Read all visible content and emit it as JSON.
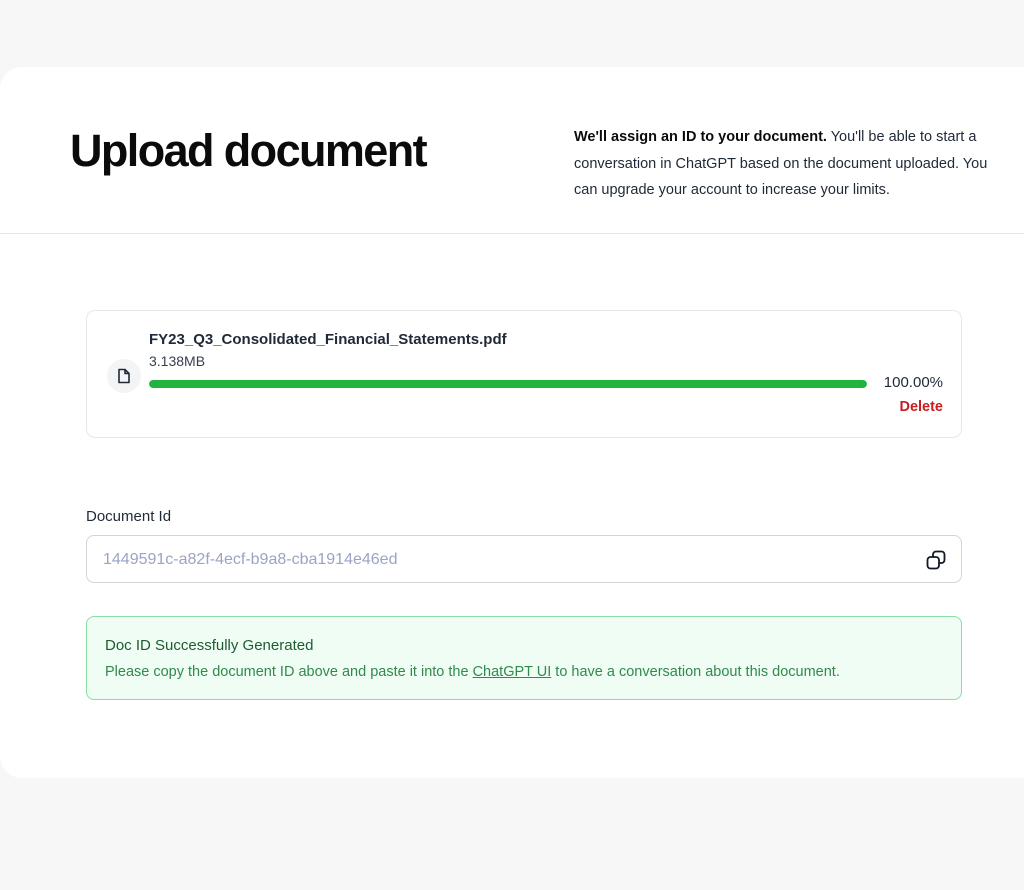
{
  "header": {
    "title": "Upload document",
    "intro_bold": "We'll assign an ID to your document.",
    "intro_rest": " You'll be able to start a conversation in ChatGPT based on the document uploaded. You can upgrade your account to increase your limits."
  },
  "file": {
    "icon": "document-icon",
    "name": "FY23_Q3_Consolidated_Financial_Statements.pdf",
    "size": "3.138MB",
    "progress_percent": 100,
    "progress_label": "100.00%",
    "delete_label": "Delete"
  },
  "document_id": {
    "label": "Document Id",
    "value": "1449591c-a82f-4ecf-b9a8-cba1914e46ed",
    "copy_icon": "copy-icon"
  },
  "success": {
    "title": "Doc ID Successfully Generated",
    "message_before": "Please copy the document ID above and paste it into the ",
    "link_text": "ChatGPT UI",
    "message_after": " to have a conversation about this document."
  },
  "colors": {
    "progress": "#22b43f",
    "delete": "#c81e1e",
    "success_border": "#86e0a3",
    "success_bg": "#f0fdf4"
  }
}
